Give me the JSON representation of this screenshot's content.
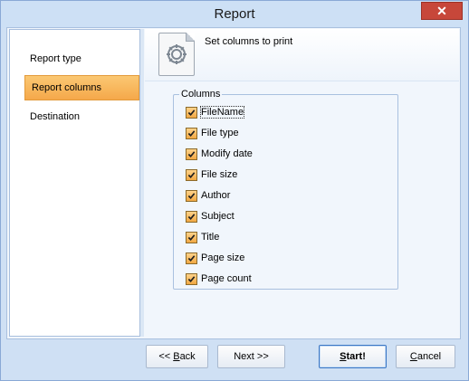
{
  "window": {
    "title": "Report",
    "close_glyph": "✕"
  },
  "sidebar": {
    "items": [
      {
        "label": "Report type"
      },
      {
        "label": "Report columns",
        "active": true
      },
      {
        "label": "Destination"
      }
    ]
  },
  "header": {
    "text": "Set columns to print",
    "icon": "gear-page-icon"
  },
  "columns_group": {
    "legend": "Columns",
    "items": [
      {
        "label": "FileName",
        "checked": true
      },
      {
        "label": "File type",
        "checked": true
      },
      {
        "label": "Modify date",
        "checked": true
      },
      {
        "label": "File size",
        "checked": true
      },
      {
        "label": "Author",
        "checked": true
      },
      {
        "label": "Subject",
        "checked": true
      },
      {
        "label": "Title",
        "checked": true
      },
      {
        "label": "Page size",
        "checked": true
      },
      {
        "label": "Page count",
        "checked": true
      }
    ]
  },
  "buttons": {
    "back_prefix": "<< ",
    "back_mnemonic": "B",
    "back_rest": "ack",
    "next": "Next >>",
    "start_mnemonic": "S",
    "start_rest": "tart!",
    "cancel_mnemonic": "C",
    "cancel_rest": "ancel"
  },
  "colors": {
    "accent": "#f5a84a",
    "frame": "#cfe0f4",
    "close": "#c7473a"
  }
}
